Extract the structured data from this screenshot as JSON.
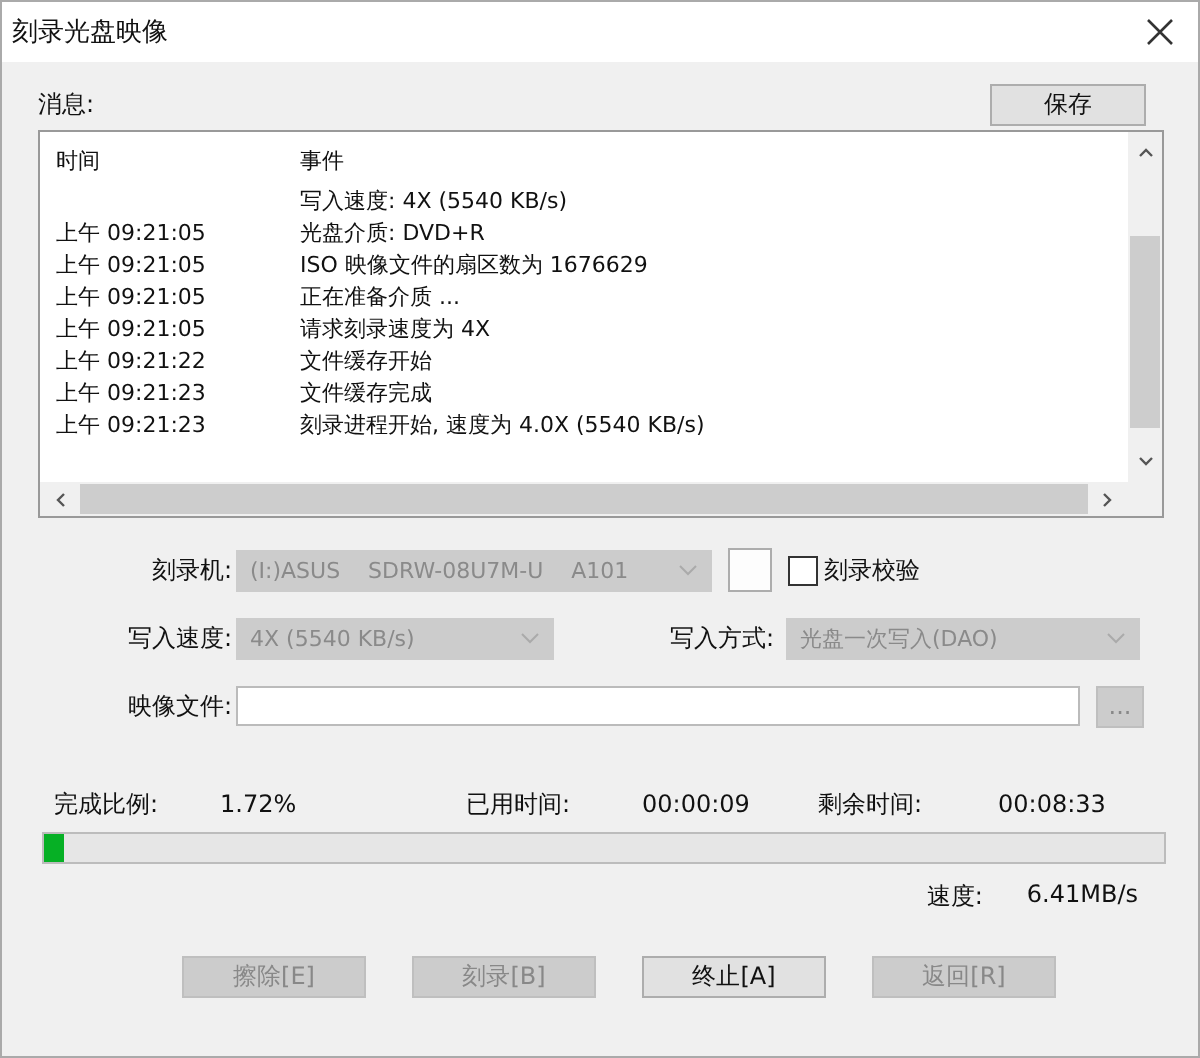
{
  "window": {
    "title": "刻录光盘映像"
  },
  "messages": {
    "label": "消息:",
    "save_button": "保存",
    "columns": [
      "时间",
      "事件"
    ],
    "rows": [
      {
        "event": "写入速度: 4X (5540 KB/s)"
      },
      {
        "time": "上午 09:21:05",
        "event": "光盘介质: DVD+R"
      },
      {
        "time": "上午 09:21:05",
        "event": "ISO 映像文件的扇区数为 1676629"
      },
      {
        "time": "上午 09:21:05",
        "event": "正在准备介质 ..."
      },
      {
        "time": "上午 09:21:05",
        "event": "请求刻录速度为 4X"
      },
      {
        "time": "上午 09:21:22",
        "event": "文件缓存开始"
      },
      {
        "time": "上午 09:21:23",
        "event": "文件缓存完成"
      },
      {
        "time": "上午 09:21:23",
        "event": "刻录进程开始, 速度为 4.0X (5540 KB/s)"
      }
    ]
  },
  "form": {
    "recorder": {
      "label": "刻录机:",
      "value": "(I:)ASUS    SDRW-08U7M-U    A101",
      "disabled": true
    },
    "verify": {
      "label": "刻录校验",
      "checked": false
    },
    "write_speed": {
      "label": "写入速度:",
      "value": "4X (5540 KB/s)",
      "disabled": true
    },
    "write_mode": {
      "label": "写入方式:",
      "value": "光盘一次写入(DAO)",
      "disabled": true
    },
    "image_file": {
      "label": "映像文件:"
    },
    "browse_button": {
      "label": "...",
      "disabled": true
    }
  },
  "progress": {
    "percent_label": "完成比例:",
    "percent": "1.72%",
    "elapsed_label": "已用时间:",
    "elapsed": "00:00:09",
    "remaining_label": "剩余时间:",
    "remaining": "00:08:33",
    "level": 0.0172,
    "speed_label": "速度:",
    "speed": "6.41MB/s"
  },
  "buttons": [
    {
      "label": "擦除[E]",
      "disabled": true
    },
    {
      "label": "刻录[B]",
      "disabled": true
    },
    {
      "label": "终止[A]",
      "disabled": false
    },
    {
      "label": "返回[R]",
      "disabled": true
    }
  ]
}
